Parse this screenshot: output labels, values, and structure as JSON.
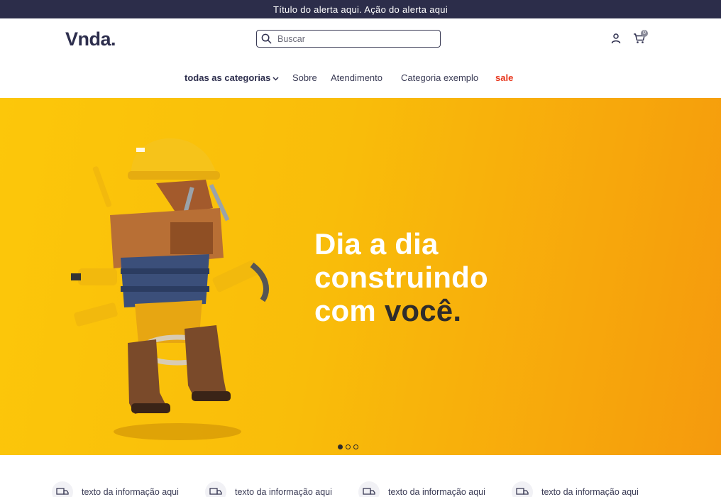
{
  "alert": {
    "text": "Título do alerta aqui. Ação do alerta aqui"
  },
  "header": {
    "logo": "Vnda.",
    "search_placeholder": "Buscar",
    "cart_count": "0",
    "icons": [
      "search-icon",
      "user-icon",
      "cart-icon"
    ]
  },
  "nav": {
    "items": [
      {
        "label": "todas as categorias",
        "has_dropdown": true
      },
      {
        "label": "Sobre"
      },
      {
        "label": "Atendimento"
      },
      {
        "label": "Categoria exemplo"
      },
      {
        "label": "sale"
      }
    ]
  },
  "banner": {
    "headline_line1": "Dia a dia",
    "headline_line2": "construindo",
    "headline_line3a": "com ",
    "headline_line3b": "você.",
    "slides": 3,
    "active_slide": 1
  },
  "info": {
    "items": [
      {
        "text": "texto da informação aqui",
        "icon": "truck-icon"
      },
      {
        "text": "texto da informação aqui",
        "icon": "truck-icon"
      },
      {
        "text": "texto da informação aqui",
        "icon": "truck-icon"
      },
      {
        "text": "texto da informação aqui",
        "icon": "truck-icon"
      }
    ]
  },
  "colors": {
    "alert_bg": "#2c2d4a",
    "brand_dark": "#2d2e4d",
    "sale_red": "#e8361c",
    "banner_yellow": "#fcc70a",
    "banner_orange": "#f59a0d"
  }
}
